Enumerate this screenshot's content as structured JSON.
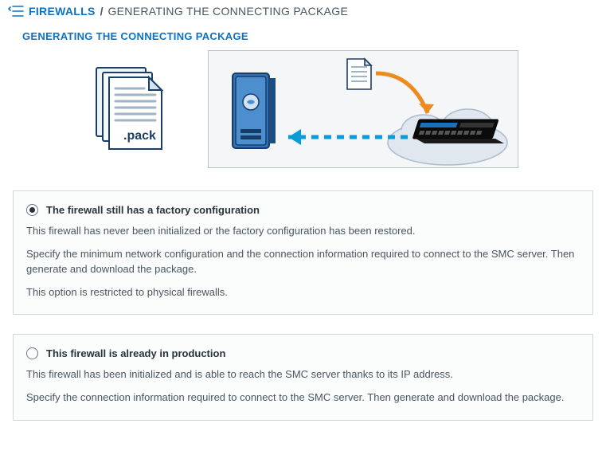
{
  "breadcrumb": {
    "root_label": "FIREWALLS",
    "current_label": "GENERATING THE CONNECTING PACKAGE"
  },
  "section_title": "GENERATING THE CONNECTING PACKAGE",
  "illustration": {
    "pack_label": ".pack"
  },
  "options": [
    {
      "selected": true,
      "title": "The firewall still has a factory configuration",
      "p1": "This firewall has never been initialized or the factory configuration has been restored.",
      "p2": "Specify the minimum network configuration and the connection information required to connect to the SMC server. Then generate and download the package.",
      "p3": "This option is restricted to physical firewalls."
    },
    {
      "selected": false,
      "title": "This firewall is already in production",
      "p1": "This firewall has been initialized and is able to reach the SMC server thanks to its IP address.",
      "p2": "Specify the connection information required to connect to the SMC server. Then generate and download the package.",
      "p3": ""
    }
  ]
}
